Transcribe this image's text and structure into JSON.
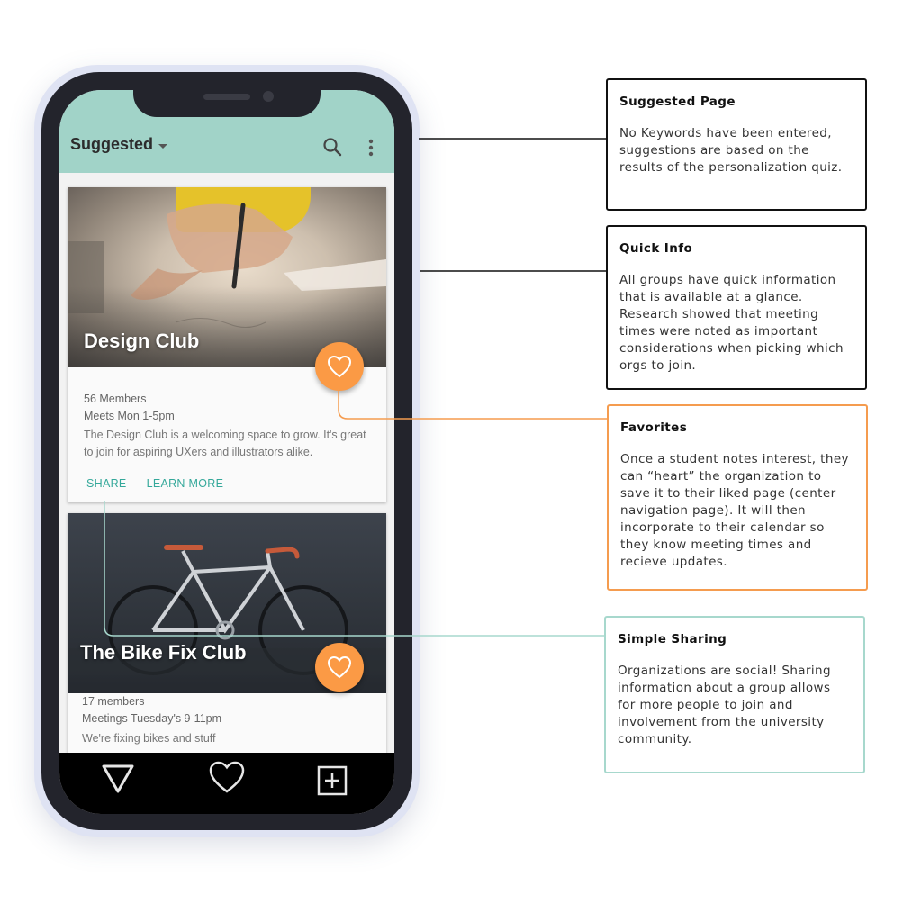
{
  "app": {
    "title": "Suggested"
  },
  "cards": [
    {
      "title": "Design Club",
      "members": "56 Members",
      "meets": "Meets Mon 1-5pm",
      "description": "The Design Club is a welcoming space to grow. It's great to join for aspiring UXers and illustrators alike.",
      "share_label": "SHARE",
      "learn_more_label": "LEARN MORE"
    },
    {
      "title": "The Bike Fix Club",
      "members": "17 members",
      "meets": "Meetings Tuesday's 9-11pm",
      "description": "We're fixing bikes and stuff"
    }
  ],
  "bottom_nav": {
    "items": [
      "triangle-icon",
      "heart-icon",
      "plus-square-icon"
    ]
  },
  "annotations": [
    {
      "title": "Suggested Page",
      "body": "No Keywords have been entered, suggestions are based on the results of the personalization quiz."
    },
    {
      "title": "Quick Info",
      "body": "All groups have quick information that is available at a glance. Research showed that meeting times were noted as important considerations when picking which orgs to join."
    },
    {
      "title": "Favorites",
      "body": "Once a student notes interest, they can “heart” the organization to save it to their liked page (center navigation page). It will then incorporate to their calendar so they know meeting times and recieve updates."
    },
    {
      "title": "Simple Sharing",
      "body": "Organizations are social! Sharing information about a group allows for more people to join and involvement from the university community."
    }
  ],
  "colors": {
    "appbar": "#a1d3c8",
    "accent": "#34a89a",
    "favorite": "#fb9a45",
    "favorites_border": "#f59c4f",
    "sharing_border": "#a7d8cd"
  }
}
